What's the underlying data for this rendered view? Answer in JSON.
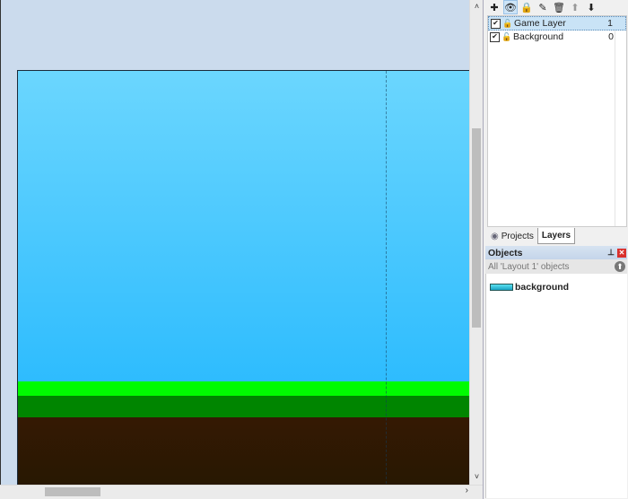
{
  "editor": {
    "layout_name": "Layout 1",
    "colors": {
      "editor_bg": "#cbdbed",
      "sky_top": "#6bd6fe",
      "sky_bottom": "#2ebcfe",
      "grass": "#00fb00",
      "dark_grass": "#008500",
      "soil": "#351903"
    },
    "scroll": {
      "up_arrow": "˄",
      "down_arrow": "˅",
      "right_arrow": "›"
    }
  },
  "layers_panel": {
    "toolbar": [
      {
        "name": "add-layer",
        "glyph": "✚"
      },
      {
        "name": "toggle-visibility",
        "glyph": "👁"
      },
      {
        "name": "lock-layer",
        "glyph": "🔒"
      },
      {
        "name": "edit-layer",
        "glyph": "✎"
      },
      {
        "name": "delete-layer",
        "glyph": "🗑"
      },
      {
        "name": "move-layer-up",
        "glyph": "⬆"
      },
      {
        "name": "move-layer-down",
        "glyph": "⬇"
      }
    ],
    "layers": [
      {
        "name": "Game Layer",
        "index": "1",
        "checked": true,
        "selected": true
      },
      {
        "name": "Background",
        "index": "0",
        "checked": true,
        "selected": false
      }
    ],
    "check_glyph": "✔",
    "lock_glyph": "🔓"
  },
  "tabs": [
    {
      "label": "Projects",
      "active": false
    },
    {
      "label": "Layers",
      "active": true
    }
  ],
  "objects_panel": {
    "title": "Objects",
    "pin_glyph": "📌",
    "close_glyph": "✕",
    "filter_label": "All 'Layout 1' objects",
    "up_glyph": "⬆",
    "items": [
      {
        "name": "background"
      }
    ]
  }
}
